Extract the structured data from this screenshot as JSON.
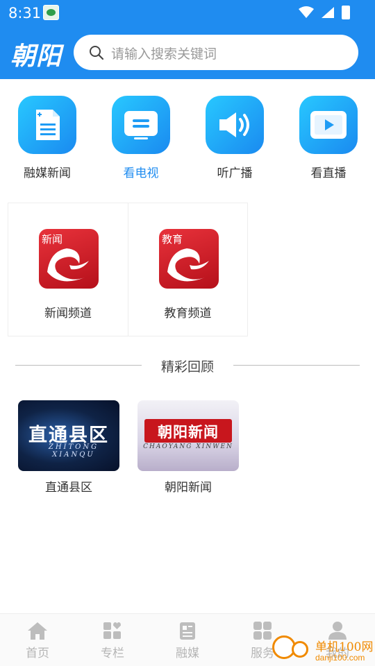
{
  "status_bar": {
    "time": "8:31"
  },
  "header": {
    "logo_text": "朝阳",
    "search_placeholder": "请输入搜索关键词"
  },
  "categories": [
    {
      "label": "融媒新闻",
      "icon": "news-doc-icon",
      "active": false
    },
    {
      "label": "看电视",
      "icon": "tv-icon",
      "active": true
    },
    {
      "label": "听广播",
      "icon": "speaker-icon",
      "active": false
    },
    {
      "label": "看直播",
      "icon": "play-icon",
      "active": false
    }
  ],
  "channels": [
    {
      "tag": "新闻",
      "name": "新闻频道"
    },
    {
      "tag": "教育",
      "name": "教育频道"
    }
  ],
  "section": {
    "title": "精彩回顾"
  },
  "replays": [
    {
      "thumb_title": "直通县区",
      "thumb_pinyin": "ZHITONG XIANQU",
      "name": "直通县区"
    },
    {
      "thumb_title": "朝阳新闻",
      "thumb_pinyin": "CHAOYANG XINWEN",
      "name": "朝阳新闻"
    }
  ],
  "bottom_nav": [
    {
      "label": "首页",
      "icon": "home-icon"
    },
    {
      "label": "专栏",
      "icon": "column-icon"
    },
    {
      "label": "融媒",
      "icon": "media-icon"
    },
    {
      "label": "服务",
      "icon": "grid-icon"
    },
    {
      "label": "我的",
      "icon": "user-icon"
    }
  ],
  "watermark": {
    "line1": "单机100网",
    "line2": "danji100.com"
  },
  "colors": {
    "primary": "#1f8cf0",
    "channel_red": "#d0202a",
    "watermark": "#f08a00"
  }
}
